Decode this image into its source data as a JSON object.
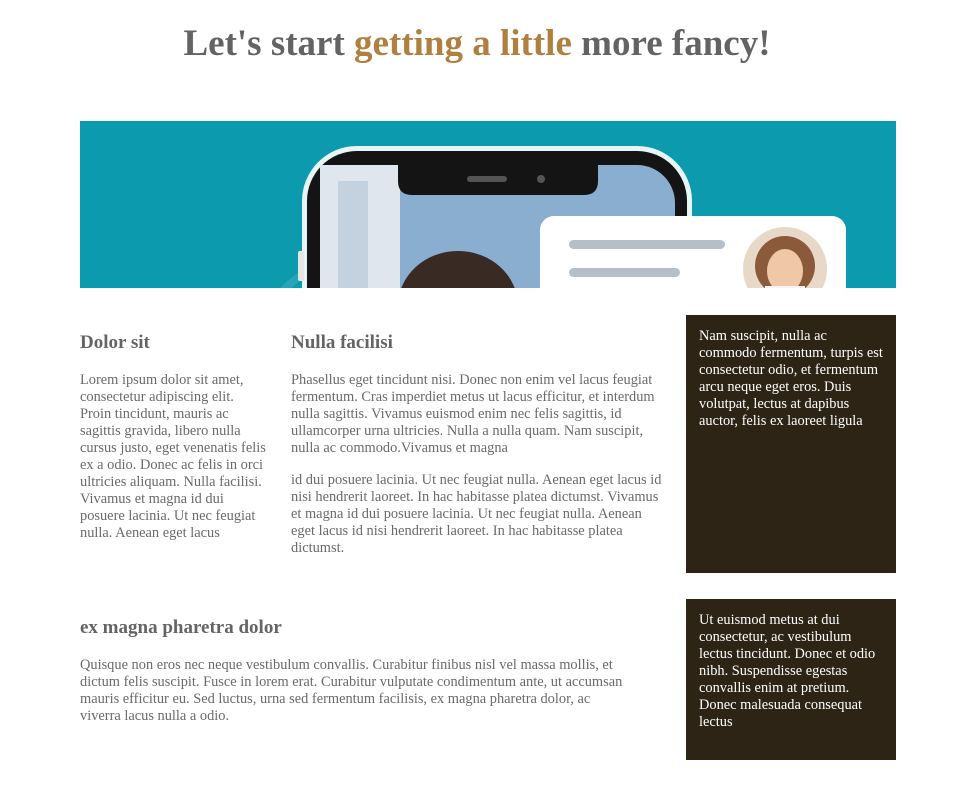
{
  "header": {
    "title_part1": "Let's start ",
    "title_accent": "getting a little",
    "title_part2": " more fancy!"
  },
  "colors": {
    "accent": "#b08040",
    "hero_bg": "#0c9aae",
    "dark_box": "#2d2416"
  },
  "col1": {
    "heading": "Dolor sit",
    "text": "Lorem ipsum dolor sit amet, consectetur adipiscing elit. Proin tincidunt, mauris ac sagittis gravida, libero nulla cursus justo, eget venenatis felis ex a odio. Donec ac felis in orci ultricies aliquam. Nulla facilisi. Vivamus et magna id dui posuere lacinia. Ut nec feugiat nulla. Aenean eget lacus"
  },
  "col2": {
    "heading": "Nulla facilisi",
    "para1": "Phasellus eget tincidunt nisi. Donec non enim vel lacus feugiat fermentum. Cras imperdiet metus ut lacus efficitur, et interdum nulla sagittis. Vivamus euismod enim nec felis sagittis, id ullamcorper urna ultricies. Nulla a nulla quam. Nam suscipit, nulla ac commodo.Vivamus et magna",
    "para2": "id dui posuere lacinia. Ut nec feugiat nulla. Aenean eget lacus id nisi hendrerit laoreet. In hac habitasse platea dictumst. Vivamus et magna id dui posuere lacinia. Ut nec feugiat nulla. Aenean eget lacus id nisi hendrerit laoreet. In hac habitasse platea dictumst."
  },
  "sidebar_box1": {
    "text": "Nam suscipit, nulla ac commodo fermentum, turpis est consectetur odio, et fermentum arcu neque eget eros. Duis volutpat, lectus at dapibus auctor, felis ex laoreet ligula"
  },
  "section2": {
    "heading": "ex magna pharetra dolor",
    "text": "Quisque non eros nec neque vestibulum convallis. Curabitur finibus nisl vel massa mollis, et dictum felis suscipit. Fusce in lorem erat. Curabitur vulputate condimentum ante, ut accumsan mauris efficitur eu. Sed luctus, urna sed fermentum facilisis, ex magna pharetra dolor, ac viverra lacus nulla a odio."
  },
  "sidebar_box2": {
    "text": "Ut euismod metus at dui consectetur, ac vestibulum lectus tincidunt. Donec et odio nibh. Suspendisse egestas convallis enim at pretium. Donec malesuada consequat lectus"
  },
  "hero": {
    "image_icon": "phone-profile-illustration"
  }
}
